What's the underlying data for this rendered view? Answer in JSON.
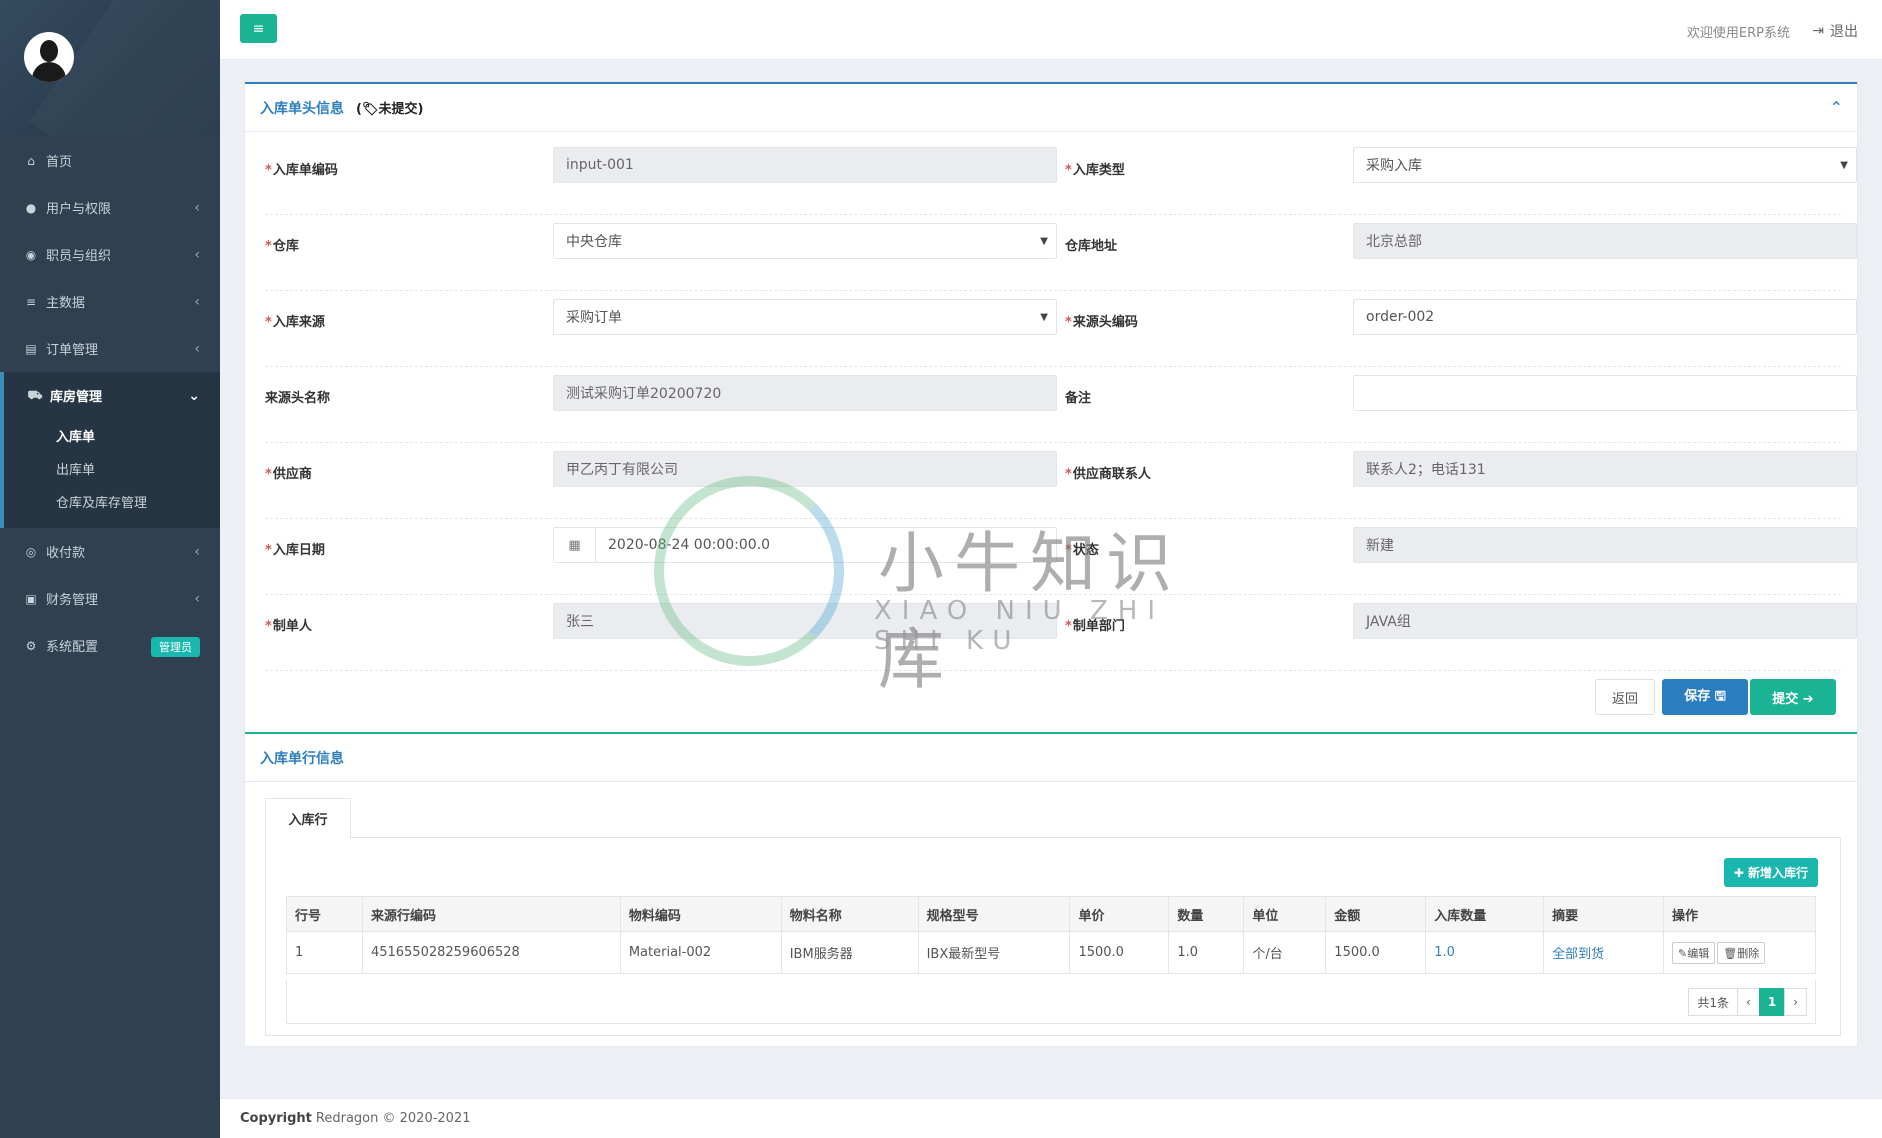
{
  "sidebar": {
    "nav": [
      {
        "label": "首页",
        "icon": "home-icon"
      },
      {
        "label": "用户与权限",
        "icon": "user-lock-icon"
      },
      {
        "label": "职员与组织",
        "icon": "user-circle-icon"
      },
      {
        "label": "主数据",
        "icon": "database-icon"
      },
      {
        "label": "订单管理",
        "icon": "list-icon"
      },
      {
        "label": "库房管理",
        "icon": "truck-icon"
      },
      {
        "label": "收付款",
        "icon": "eye-icon"
      },
      {
        "label": "财务管理",
        "icon": "money-icon"
      },
      {
        "label": "系统配置",
        "icon": "gear-icon",
        "badge": "管理员"
      }
    ],
    "sub_items": [
      "入库单",
      "出库单",
      "仓库及库存管理"
    ]
  },
  "topbar": {
    "welcome": "欢迎使用ERP系统",
    "logout": "退出"
  },
  "header_section": {
    "title": "入库单头信息",
    "status": "(🏷未提交)"
  },
  "form": {
    "code_label": "入库单编码",
    "code_value": "input-001",
    "type_label": "入库类型",
    "type_value": "采购入库",
    "warehouse_label": "仓库",
    "warehouse_value": "中央仓库",
    "address_label": "仓库地址",
    "address_value": "北京总部",
    "source_label": "入库来源",
    "source_value": "采购订单",
    "source_code_label": "来源头编码",
    "source_code_value": "order-002",
    "source_name_label": "来源头名称",
    "source_name_value": "测试采购订单20200720",
    "remark_label": "备注",
    "remark_value": "",
    "supplier_label": "供应商",
    "supplier_value": "甲乙丙丁有限公司",
    "contact_label": "供应商联系人",
    "contact_value": "联系人2；电话131",
    "date_label": "入库日期",
    "date_value": "2020-08-24 00:00:00.0",
    "state_label": "状态",
    "state_value": "新建",
    "creator_label": "制单人",
    "creator_value": "张三",
    "dept_label": "制单部门",
    "dept_value": "JAVA组"
  },
  "buttons": {
    "back": "返回",
    "save": "保存 🖫",
    "submit": "提交 ➔"
  },
  "lines_section": {
    "title": "入库单行信息",
    "tab": "入库行",
    "add_button": "新增入库行",
    "columns": [
      "行号",
      "来源行编码",
      "物料编码",
      "物料名称",
      "规格型号",
      "单价",
      "数量",
      "单位",
      "金额",
      "入库数量",
      "摘要",
      "操作"
    ],
    "rows": [
      {
        "no": "1",
        "src_code": "451655028259606528",
        "mat_code": "Material-002",
        "mat_name": "IBM服务器",
        "spec": "IBX最新型号",
        "price": "1500.0",
        "qty": "1.0",
        "unit": "个/台",
        "amount": "1500.0",
        "in_qty": "1.0",
        "summary": "全部到货",
        "edit": "编辑",
        "delete": "删除"
      }
    ],
    "pager": {
      "total": "共1条",
      "prev": "‹",
      "current": "1",
      "next": "›"
    }
  },
  "footer": {
    "copyright_label": "Copyright",
    "copyright_text": "Redragon © 2020-2021"
  },
  "watermark": {
    "text": "小牛知识库",
    "sub": "XIAO NIU ZHI SHI KU"
  },
  "colors": {
    "sidebar_bg": "#2f4050",
    "primary": "#2a7ec0",
    "accent": "#1ab394",
    "required": "#d9534f"
  }
}
